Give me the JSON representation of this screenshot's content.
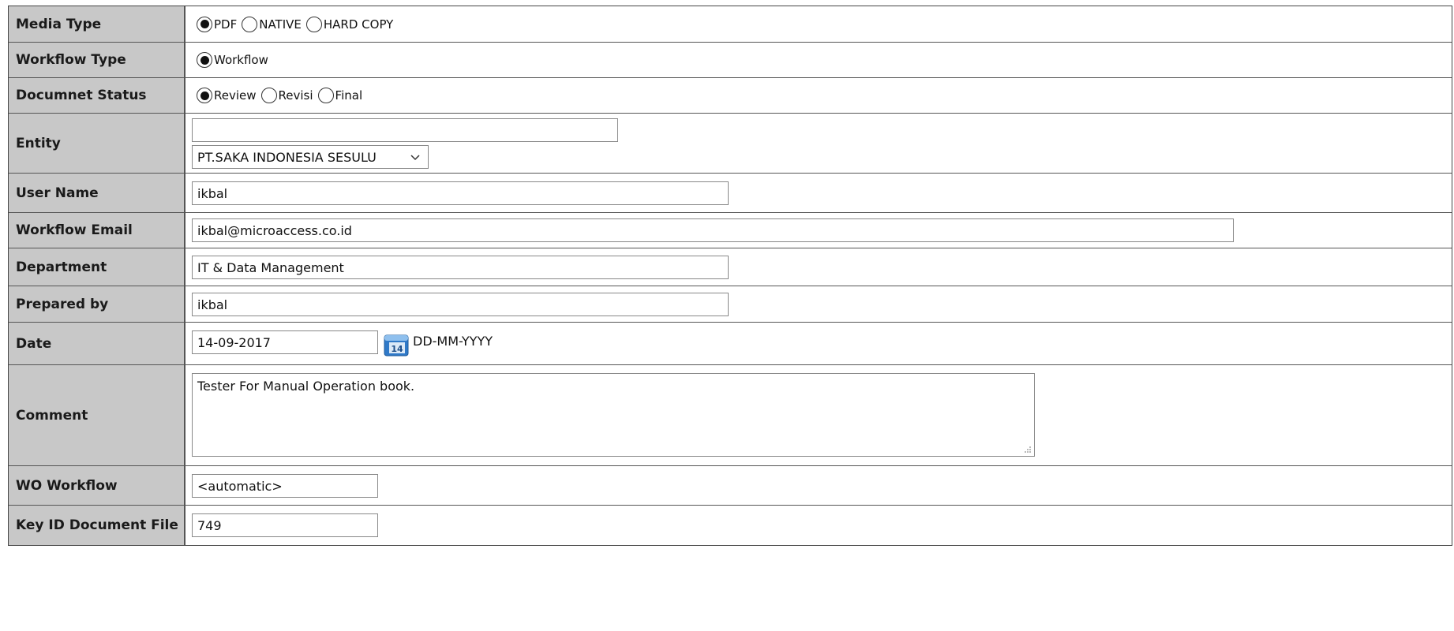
{
  "form": {
    "media_type": {
      "label": "Media Type",
      "options": [
        "PDF",
        "NATIVE",
        "HARD COPY"
      ],
      "selected": "PDF"
    },
    "workflow_type": {
      "label": "Workflow Type",
      "options": [
        "Workflow"
      ],
      "selected": "Workflow"
    },
    "document_status": {
      "label": "Documnet Status",
      "options": [
        "Review",
        "Revisi",
        "Final"
      ],
      "selected": "Review"
    },
    "entity": {
      "label": "Entity",
      "text_value": "",
      "select_value": "PT.SAKA INDONESIA SESULU"
    },
    "user_name": {
      "label": "User Name",
      "value": "ikbal"
    },
    "workflow_email": {
      "label": "Workflow Email",
      "value": "ikbal@microaccess.co.id"
    },
    "department": {
      "label": "Department",
      "value": "IT & Data Management"
    },
    "prepared_by": {
      "label": "Prepared by",
      "value": "ikbal"
    },
    "date": {
      "label": "Date",
      "value": "14-09-2017",
      "format_hint": "DD-MM-YYYY",
      "calendar_icon_text": "14"
    },
    "comment": {
      "label": "Comment",
      "value": "Tester For Manual Operation book."
    },
    "wo_workflow": {
      "label": "WO Workflow",
      "value": "<automatic>"
    },
    "key_id": {
      "label": "Key ID Document File",
      "value": "749"
    }
  },
  "icons": {
    "calendar": "calendar-icon",
    "dropdown": "chevron-down-icon",
    "resize": "resize-grip-icon"
  },
  "colors": {
    "label_bg": "#c8c8c8",
    "border": "#555555",
    "calendar_blue": "#2f79c8"
  }
}
